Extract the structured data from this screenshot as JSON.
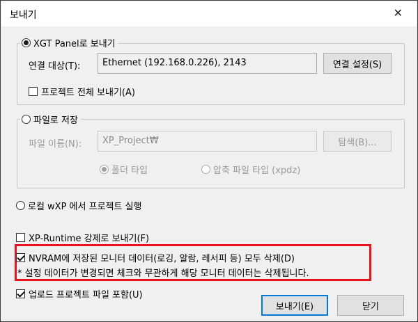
{
  "window": {
    "title": "보내기",
    "close_glyph": "✕"
  },
  "xgt_panel": {
    "label": "XGT Panel로 보내기",
    "selected": true,
    "target_label": "연결 대상(T):",
    "target_value": "Ethernet (192.168.0.226), 2143",
    "connection_button": "연결 설정(S)",
    "send_all_label": "프로젝트 전체 보내기(A)",
    "send_all_checked": false
  },
  "save_file": {
    "label": "파일로 저장",
    "selected": false,
    "filename_label": "파일 이름(N):",
    "filename_value": "XP_Project₩",
    "browse_button": "탐색(B)...",
    "folder_type_label": "폴더 타입",
    "folder_type_selected": true,
    "zip_type_label": "압축 파일 타입 (xpdz)",
    "zip_type_selected": false
  },
  "local_run": {
    "label": "로컬 wXP 에서 프로젝트 실행",
    "selected": false
  },
  "xp_runtime": {
    "label": "XP-Runtime 강제로 보내기(F)",
    "checked": false
  },
  "nvram": {
    "label": "NVRAM에 저장된 모니터 데이터(로깅, 알람, 레서피 등) 모두 삭제(D)",
    "checked": true,
    "note": "* 설정 데이터가 변경되면 체크와 무관하게 해당 모니터 데이터는 삭제됩니다."
  },
  "upload_include": {
    "label": "업로드 프로젝트 파일 포함(U)",
    "checked": true
  },
  "buttons": {
    "send": "보내기(E)",
    "close": "닫기"
  },
  "colors": {
    "highlight_border": "#e8141c",
    "default_button_border": "#0078d7"
  }
}
